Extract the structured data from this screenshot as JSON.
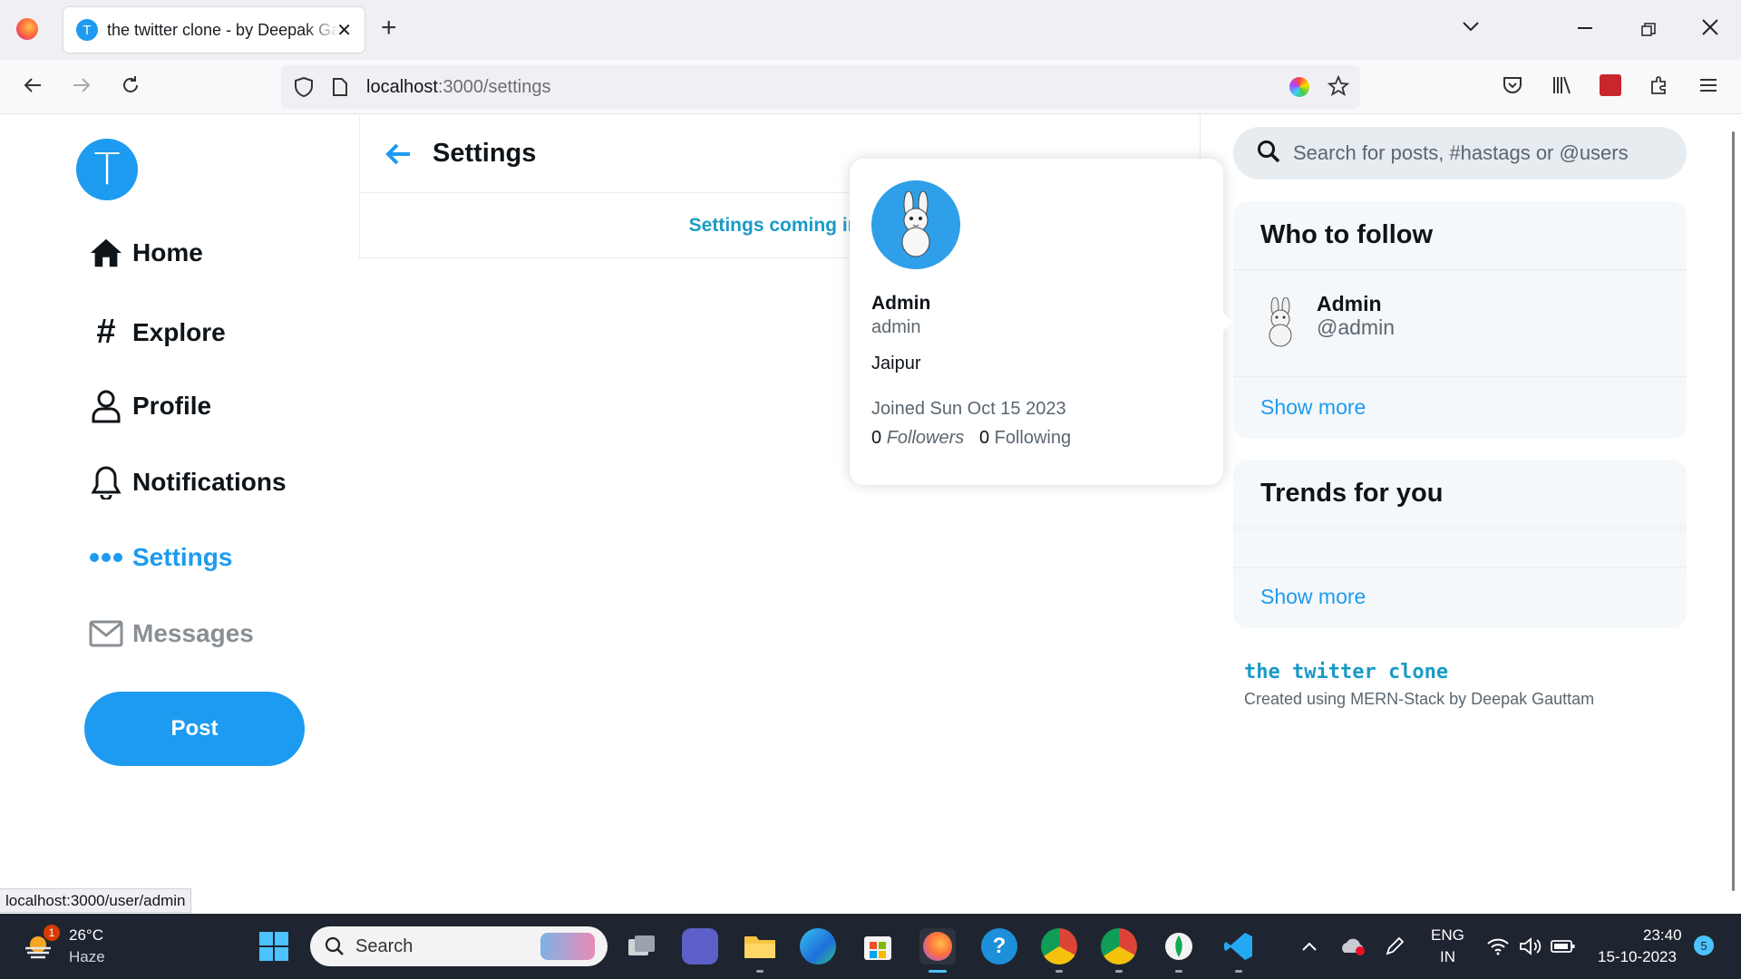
{
  "browser": {
    "tab_title": "the twitter clone - by Deepak Gauttam",
    "tab_favicon_letter": "T",
    "url_host": "localhost",
    "url_path": ":3000/settings",
    "status_link": "localhost:3000/user/admin"
  },
  "sidebar": {
    "logo_letter": "T",
    "items": [
      {
        "label": "Home",
        "icon": "home-icon"
      },
      {
        "label": "Explore",
        "icon": "hashtag-icon"
      },
      {
        "label": "Profile",
        "icon": "user-icon"
      },
      {
        "label": "Notifications",
        "icon": "bell-icon"
      },
      {
        "label": "Settings",
        "icon": "more-dots-icon"
      },
      {
        "label": "Messages",
        "icon": "envelope-icon"
      }
    ],
    "post_label": "Post"
  },
  "main": {
    "title": "Settings",
    "message": "Settings coming in f"
  },
  "search": {
    "placeholder": "Search for posts, #hastags or @users"
  },
  "who_to_follow": {
    "title": "Who to follow",
    "users": [
      {
        "name": "Admin",
        "handle": "@admin"
      }
    ],
    "show_more": "Show more"
  },
  "trends": {
    "title": "Trends for you",
    "show_more": "Show more"
  },
  "footer": {
    "title": "the twitter clone",
    "subtitle": "Created using MERN-Stack by Deepak Gauttam"
  },
  "hover_card": {
    "name": "Admin",
    "handle": "admin",
    "location": "Jaipur",
    "joined": "Joined Sun Oct 15 2023",
    "followers_count": "0",
    "followers_label": "Followers",
    "following_count": "0",
    "following_label": "Following"
  },
  "taskbar": {
    "weather_temp": "26°C",
    "weather_desc": "Haze",
    "weather_badge": "1",
    "search_label": "Search",
    "lang_top": "ENG",
    "lang_bottom": "IN",
    "time": "23:40",
    "date": "15-10-2023",
    "notification_count": "5"
  },
  "colors": {
    "accent": "#1d9bf0",
    "footer_link": "#1a9bc5",
    "taskbar_bg": "#1e2530"
  }
}
